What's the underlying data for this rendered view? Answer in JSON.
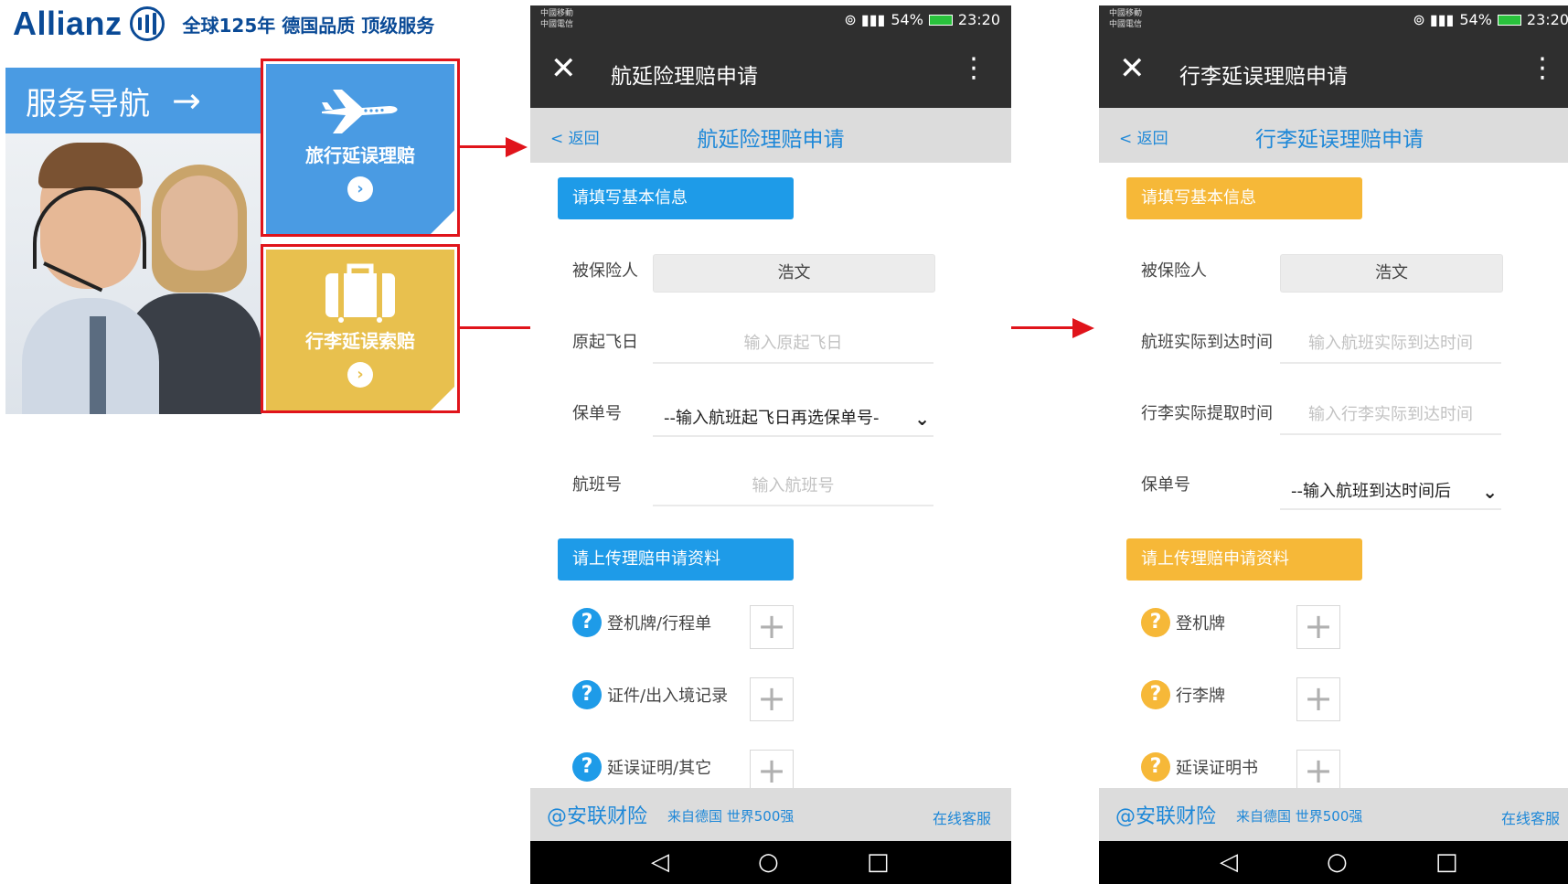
{
  "left": {
    "brand": "Allianz",
    "slogan": "全球125年 德国品质 顶级服务",
    "nav_header": "服务导航",
    "nav_arrow": "→",
    "tiles": [
      {
        "label": "旅行延误理赔",
        "go": "›"
      },
      {
        "label": "行李延误索赔",
        "go": "›"
      }
    ]
  },
  "phones": [
    {
      "status": {
        "carrier1": "中國移動",
        "carrier2": "中國電信",
        "right": "54%",
        "time": "23:20"
      },
      "window_title": "航延险理赔申请",
      "close_glyph": "✕",
      "more_glyph": "⋮",
      "back": "< 返回",
      "page_title": "航延险理赔申请",
      "section1": "请填写基本信息",
      "fields": [
        {
          "label": "被保险人",
          "value": "浩文"
        },
        {
          "label": "原起飞日",
          "placeholder": "输入原起飞日"
        },
        {
          "label": "保单号",
          "value": "--输入航班起飞日再选保单号-"
        },
        {
          "label": "航班号",
          "placeholder": "输入航班号"
        }
      ],
      "section2": "请上传理赔申请资料",
      "uploads": [
        {
          "label": "登机牌/行程单"
        },
        {
          "label": "证件/出入境记录"
        },
        {
          "label": "延误证明/其它"
        }
      ],
      "footer": {
        "brand": "@安联财险",
        "slogan": "来自德国 世界500强",
        "service": "在线客服"
      },
      "nav": {
        "back": "◁",
        "home": "○",
        "recent": "□"
      }
    },
    {
      "status": {
        "carrier1": "中國移動",
        "carrier2": "中國電信",
        "right": "54%",
        "time": "23:20"
      },
      "window_title": "行李延误理赔申请",
      "close_glyph": "✕",
      "more_glyph": "⋮",
      "back": "< 返回",
      "page_title": "行李延误理赔申请",
      "section1": "请填写基本信息",
      "fields": [
        {
          "label": "被保险人",
          "value": "浩文"
        },
        {
          "label": "航班实际到达时间",
          "placeholder": "输入航班实际到达时间"
        },
        {
          "label": "行李实际提取时间",
          "placeholder": "输入行李实际到达时间"
        },
        {
          "label": "保单号",
          "value": "--输入航班到达时间后"
        }
      ],
      "section2": "请上传理赔申请资料",
      "uploads": [
        {
          "label": "登机牌"
        },
        {
          "label": "行李牌"
        },
        {
          "label": "延误证明书"
        }
      ],
      "footer": {
        "brand": "@安联财险",
        "slogan": "来自德国 世界500强",
        "service": "在线客服"
      },
      "nav": {
        "back": "◁",
        "home": "○",
        "recent": "□"
      }
    }
  ],
  "colors": {
    "brand_blue": "#0a4a96",
    "tile_blue": "#4a9be3",
    "tile_yellow": "#e8c04e",
    "section_blue": "#1e9be8",
    "section_orange": "#f6b838",
    "link_blue": "#1e88d8",
    "arrow_red": "#e0141b"
  },
  "icons": {
    "plane": "airplane-icon",
    "luggage": "suitcase-icon",
    "help": "question-icon",
    "upload": "plus-icon"
  }
}
